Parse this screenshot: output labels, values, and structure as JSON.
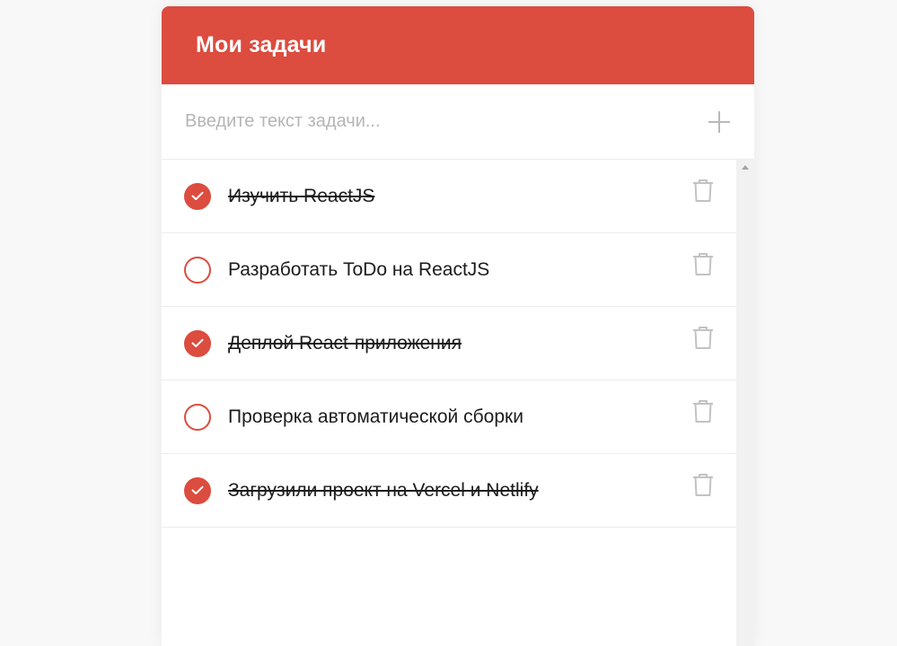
{
  "header": {
    "title": "Мои задачи"
  },
  "add": {
    "placeholder": "Введите текст задачи...",
    "value": "",
    "button_icon": "plus-icon"
  },
  "tasks": [
    {
      "text": "Изучить ReactJS",
      "done": true
    },
    {
      "text": "Разработать ToDo на ReactJS",
      "done": false
    },
    {
      "text": "Деплой React-приложения",
      "done": true
    },
    {
      "text": "Проверка автоматической сборки",
      "done": false
    },
    {
      "text": "Загрузили проект на Vercel и Netlify",
      "done": true
    }
  ],
  "icons": {
    "checkbox": "check-circle-icon",
    "delete": "trash-icon"
  },
  "colors": {
    "accent": "#dc4c3f",
    "background": "#f8f8f8",
    "muted": "#b9b9b9"
  }
}
